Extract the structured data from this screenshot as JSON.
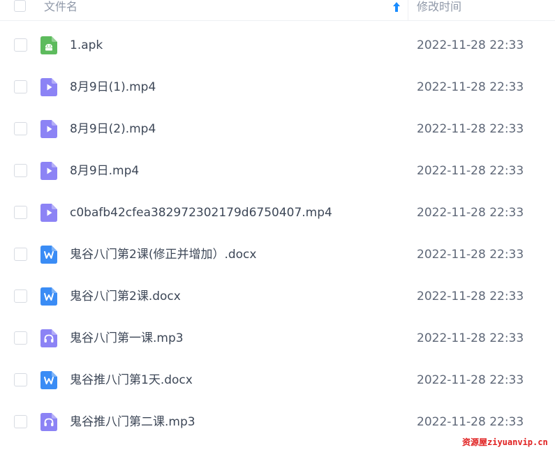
{
  "header": {
    "name_label": "文件名",
    "time_label": "修改时间",
    "sort_icon": "arrow-up-icon",
    "accent": "#1a8cff"
  },
  "files": [
    {
      "name": "1.apk",
      "time": "2022-11-28 22:33",
      "type": "apk",
      "icon": "android-icon"
    },
    {
      "name": "8月9日(1).mp4",
      "time": "2022-11-28 22:33",
      "type": "video",
      "icon": "video-play-icon"
    },
    {
      "name": "8月9日(2).mp4",
      "time": "2022-11-28 22:33",
      "type": "video",
      "icon": "video-play-icon"
    },
    {
      "name": "8月9日.mp4",
      "time": "2022-11-28 22:33",
      "type": "video",
      "icon": "video-play-icon"
    },
    {
      "name": "c0bafb42cfea382972302179d6750407.mp4",
      "time": "2022-11-28 22:33",
      "type": "video",
      "icon": "video-play-icon"
    },
    {
      "name": "鬼谷八门第2课(修正并增加）.docx",
      "time": "2022-11-28 22:33",
      "type": "word",
      "icon": "word-doc-icon"
    },
    {
      "name": "鬼谷八门第2课.docx",
      "time": "2022-11-28 22:33",
      "type": "word",
      "icon": "word-doc-icon"
    },
    {
      "name": "鬼谷八门第一课.mp3",
      "time": "2022-11-28 22:33",
      "type": "audio",
      "icon": "audio-headphones-icon"
    },
    {
      "name": "鬼谷推八门第1天.docx",
      "time": "2022-11-28 22:33",
      "type": "word",
      "icon": "word-doc-icon"
    },
    {
      "name": "鬼谷推八门第二课.mp3",
      "time": "2022-11-28 22:33",
      "type": "audio",
      "icon": "audio-headphones-icon"
    }
  ],
  "icon_colors": {
    "apk": "#5dbb5d",
    "video": "#8c83f5",
    "word": "#3a8cf5",
    "audio": "#8c83f5"
  },
  "watermark": "资源屋ziyuanvip.cn"
}
